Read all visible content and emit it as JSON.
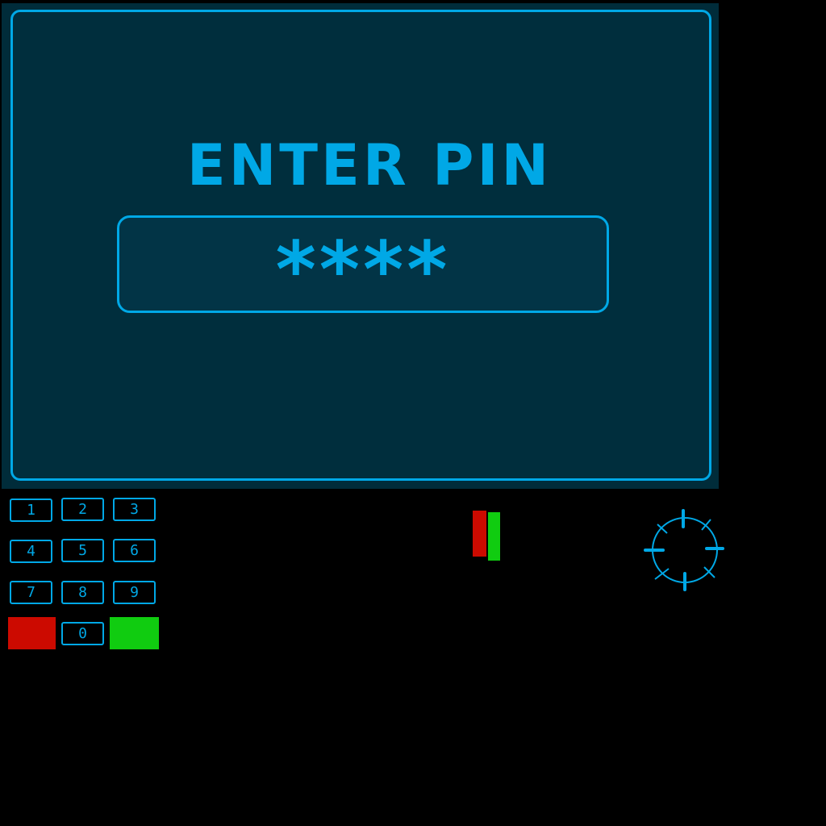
{
  "screen": {
    "title": "ENTER PIN",
    "pin_mask": "****"
  },
  "keypad": {
    "keys": [
      "1",
      "2",
      "3",
      "4",
      "5",
      "6",
      "7",
      "8",
      "9",
      "0"
    ]
  },
  "colors": {
    "accent": "#00a8e6",
    "screen_bg": "#002e3d",
    "cancel": "#cc0a00",
    "enter": "#10cc10"
  },
  "icons": {
    "crosshair": "crosshair-icon"
  }
}
